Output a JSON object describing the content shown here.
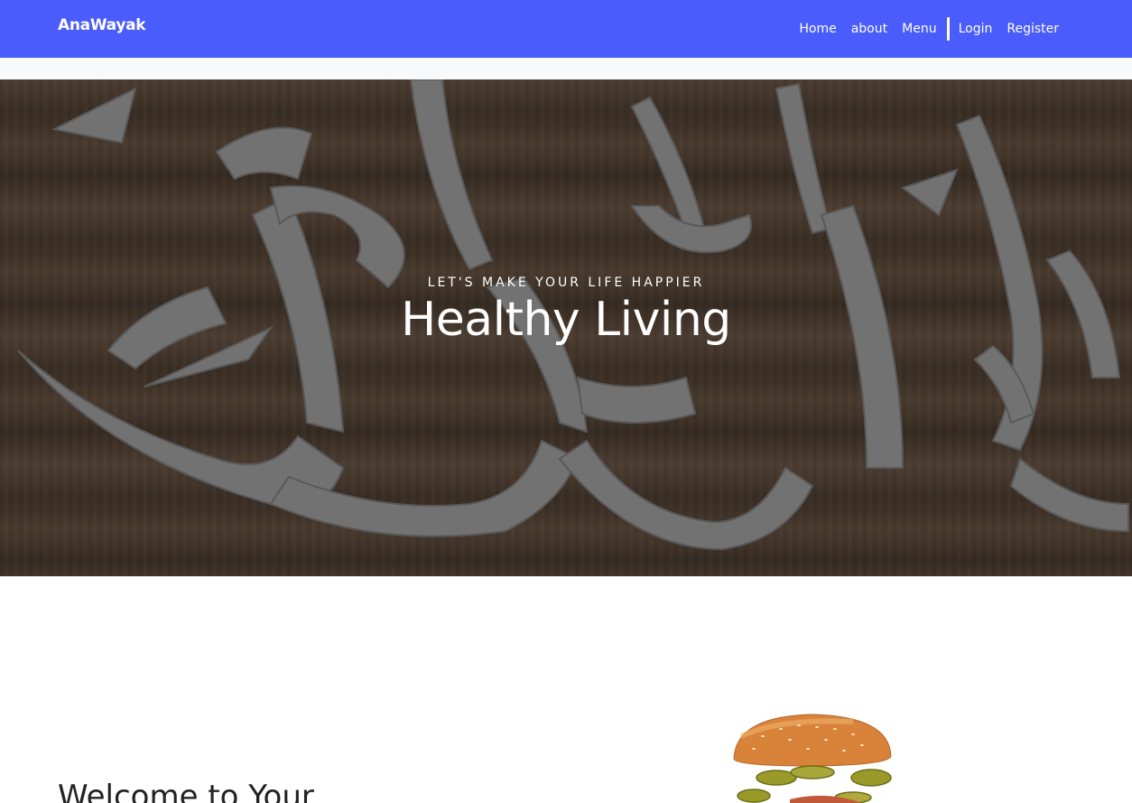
{
  "navbar": {
    "brand": "AnaWayak",
    "links": [
      {
        "label": "Home"
      },
      {
        "label": "about"
      },
      {
        "label": "Menu"
      },
      {
        "label": "Login"
      },
      {
        "label": "Register"
      }
    ],
    "color": "#4a5cfb"
  },
  "hero": {
    "subtitle": "LET'S MAKE YOUR LIFE HAPPIER",
    "title": "Healthy Living"
  },
  "welcome": {
    "heading": "Welcome to Your"
  },
  "icons": [
    "burger-image",
    "calligraphy-background"
  ]
}
